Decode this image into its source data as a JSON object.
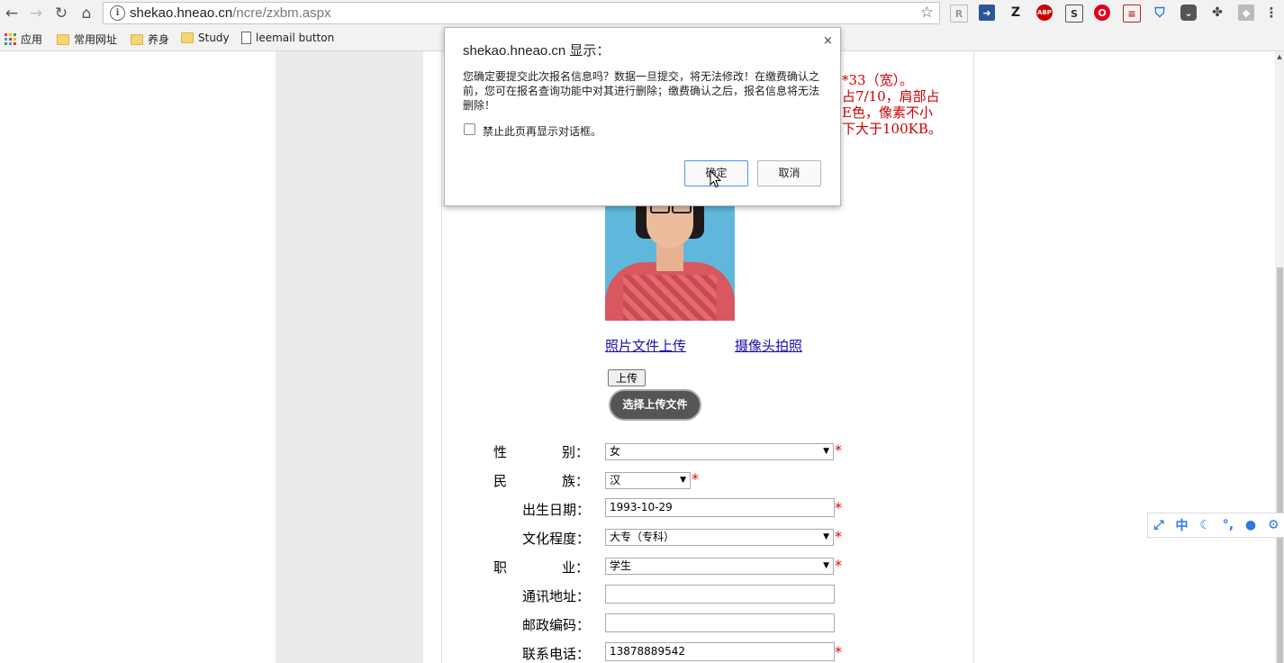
{
  "browser": {
    "url_domain": "shekao.hneao.cn",
    "url_path": "/ncre/zxbm.aspx",
    "info_icon": "ⓘ",
    "bookmarks": [
      "应用",
      "常用网址",
      "养身",
      "Study",
      "leemail button"
    ],
    "extensions": [
      "readability-icon",
      "send-icon",
      "zotero-icon",
      "adblock-icon",
      "s-icon",
      "opera-icon",
      "notes-icon",
      "shield-icon",
      "pocket-icon",
      "puzzle-icon",
      "gray-icon"
    ]
  },
  "dialog": {
    "title": "shekao.hneao.cn 显示：",
    "message": "您确定要提交此次报名信息吗？数据一旦提交，将无法修改！在缴费确认之前，您可在报名查询功能中对其进行删除；缴费确认之后，报名信息将无法删除！",
    "suppress_label": "禁止此页再显示对话框。",
    "ok_label": "确定",
    "cancel_label": "取消",
    "close_glyph": "×"
  },
  "notice_lines": [
    "*33（宽）。",
    "占7/10，肩部占",
    "E色，像素不小",
    "下大于100KB。"
  ],
  "photo": {
    "file_upload_link": "照片文件上传",
    "camera_link": "摄像头拍照",
    "upload_label": "上传",
    "choose_file_label": "选择上传文件"
  },
  "form": {
    "gender": {
      "label_a": "性",
      "label_b": "别：",
      "value": "女"
    },
    "ethnicity": {
      "label_a": "民",
      "label_b": "族：",
      "value": "汉"
    },
    "birth_date": {
      "label": "出生日期：",
      "value": "1993-10-29"
    },
    "education": {
      "label": "文化程度：",
      "value": "大专（专科）"
    },
    "occupation": {
      "label_a": "职",
      "label_b": "业：",
      "value": "学生"
    },
    "address": {
      "label": "通讯地址：",
      "value": ""
    },
    "postal_code": {
      "label": "邮政编码：",
      "value": ""
    },
    "phone": {
      "label": "联系电话：",
      "value": "13878889542"
    },
    "required_mark": "*"
  },
  "ime_bar": {
    "items": [
      "⤢",
      "中",
      "☾",
      "°,",
      "●",
      "⚙"
    ]
  }
}
